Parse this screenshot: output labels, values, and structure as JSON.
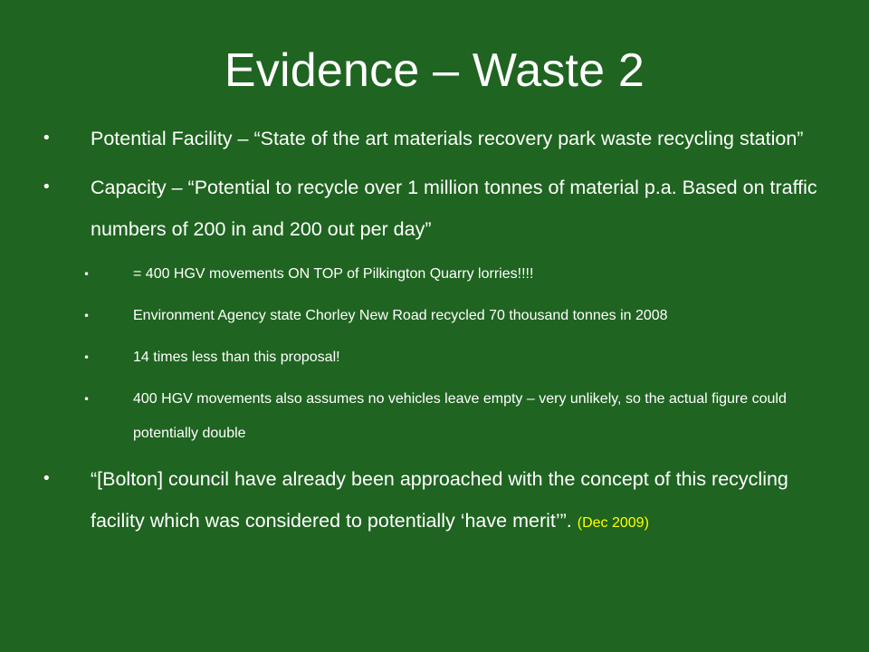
{
  "slide": {
    "title": "Evidence – Waste 2",
    "bullet_glyph": "•",
    "bullets": [
      {
        "level": 1,
        "text": "Potential Facility – “State of the art materials recovery park waste recycling station”"
      },
      {
        "level": 1,
        "text": "Capacity – “Potential to recycle over 1 million tonnes of material p.a. Based on traffic numbers of 200 in and 200 out per day”"
      },
      {
        "level": 2,
        "text": "= 400 HGV movements ON TOP of Pilkington Quarry lorries!!!!"
      },
      {
        "level": 2,
        "text": "Environment Agency state Chorley New Road recycled 70 thousand tonnes in 2008"
      },
      {
        "level": 2,
        "text": "14 times less than this proposal!"
      },
      {
        "level": 2,
        "text": "400 HGV movements also assumes no vehicles leave empty – very unlikely, so the actual figure could potentially double"
      },
      {
        "level": 1,
        "text": "“[Bolton] council have already been approached with the concept of this recycling facility which was considered to potentially ‘have merit’”.",
        "date": "(Dec 2009)"
      }
    ],
    "colors": {
      "background": "#1f6420",
      "text": "#ffffff",
      "date": "#ffff00"
    }
  }
}
